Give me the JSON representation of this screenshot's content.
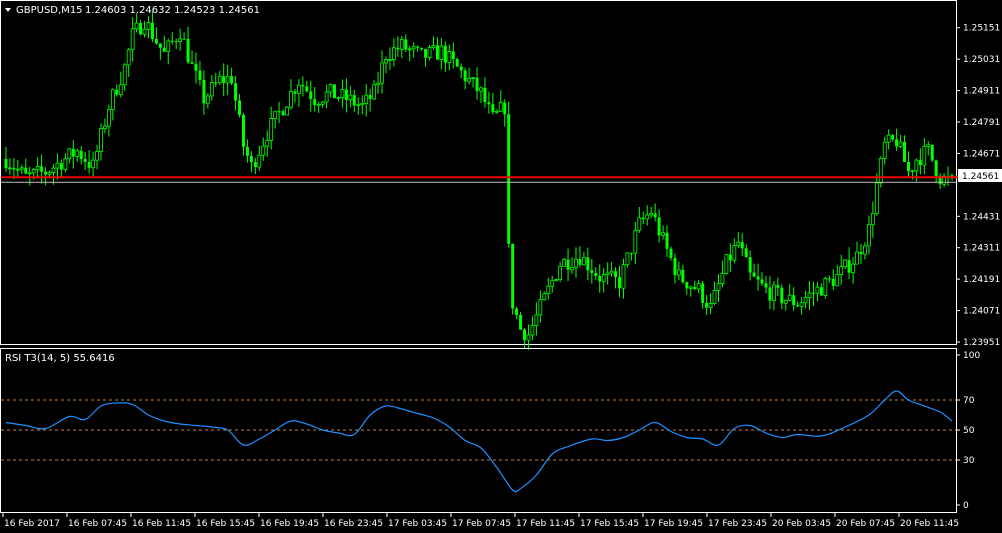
{
  "colors": {
    "background": "#000000",
    "foreground": "#ffffff",
    "bull_candle": "#00ff00",
    "bear_candle": "#00ff00",
    "price_line": "#ff0000",
    "rsi_line": "#1e90ff",
    "level_line": "#c08040",
    "panel_border": "#ffffff"
  },
  "chart_data": [
    {
      "type": "candlestick",
      "title": "GBPUSD,M15  1.24603 1.24632 1.24523 1.24561",
      "symbol": "GBPUSD,M15",
      "ohlc_label": "1.24603 1.24632 1.24523 1.24561",
      "collapse_icon": "triangle-down-icon",
      "ylim": [
        1.23951,
        1.25211
      ],
      "y_ticks": [
        "1.25151",
        "1.25031",
        "1.24911",
        "1.24791",
        "1.24671",
        "1.24431",
        "1.24311",
        "1.24191",
        "1.24071",
        "1.23951"
      ],
      "current_price": 1.24561,
      "current_price_label": "1.24561",
      "extra_levels": [
        1.24582,
        1.24578
      ],
      "candle_count": 240,
      "anchors": [
        [
          0,
          1.2465
        ],
        [
          5,
          1.2458
        ],
        [
          10,
          1.246
        ],
        [
          15,
          1.2465
        ],
        [
          18,
          1.2468
        ],
        [
          22,
          1.2462
        ],
        [
          26,
          1.2485
        ],
        [
          30,
          1.25
        ],
        [
          32,
          1.2512
        ],
        [
          35,
          1.2518
        ],
        [
          38,
          1.251
        ],
        [
          40,
          1.2505
        ],
        [
          44,
          1.2514
        ],
        [
          47,
          1.25
        ],
        [
          50,
          1.2488
        ],
        [
          54,
          1.2495
        ],
        [
          57,
          1.2496
        ],
        [
          60,
          1.247
        ],
        [
          62,
          1.2462
        ],
        [
          66,
          1.2475
        ],
        [
          70,
          1.2485
        ],
        [
          74,
          1.2495
        ],
        [
          78,
          1.2488
        ],
        [
          82,
          1.249
        ],
        [
          86,
          1.2488
        ],
        [
          90,
          1.2485
        ],
        [
          93,
          1.249
        ],
        [
          96,
          1.2505
        ],
        [
          100,
          1.2508
        ],
        [
          105,
          1.2504
        ],
        [
          110,
          1.2506
        ],
        [
          115,
          1.2498
        ],
        [
          120,
          1.249
        ],
        [
          123,
          1.248
        ],
        [
          126,
          1.2485
        ],
        [
          127,
          1.243
        ],
        [
          128,
          1.241
        ],
        [
          130,
          1.24
        ],
        [
          132,
          1.2398
        ],
        [
          135,
          1.2408
        ],
        [
          140,
          1.2425
        ],
        [
          145,
          1.2428
        ],
        [
          150,
          1.242
        ],
        [
          155,
          1.2418
        ],
        [
          160,
          1.244
        ],
        [
          163,
          1.2445
        ],
        [
          167,
          1.243
        ],
        [
          170,
          1.242
        ],
        [
          175,
          1.2415
        ],
        [
          178,
          1.2408
        ],
        [
          182,
          1.2425
        ],
        [
          185,
          1.2433
        ],
        [
          188,
          1.242
        ],
        [
          192,
          1.2415
        ],
        [
          196,
          1.2412
        ],
        [
          200,
          1.241
        ],
        [
          205,
          1.2415
        ],
        [
          210,
          1.242
        ],
        [
          215,
          1.2428
        ],
        [
          218,
          1.2438
        ],
        [
          220,
          1.2455
        ],
        [
          222,
          1.247
        ],
        [
          225,
          1.2472
        ],
        [
          228,
          1.246
        ],
        [
          230,
          1.2465
        ],
        [
          233,
          1.2468
        ],
        [
          236,
          1.2458
        ],
        [
          239,
          1.2456
        ]
      ]
    },
    {
      "type": "line",
      "title": "RSI T3(14, 5) 55.6416",
      "series": [
        {
          "name": "RSI T3(14, 5)",
          "last_value": "55.6416"
        }
      ],
      "ylim": [
        0,
        100
      ],
      "y_ticks": [
        "100",
        "70",
        "50",
        "30",
        "0"
      ],
      "levels": [
        70,
        50,
        30
      ],
      "x": [
        0,
        5,
        10,
        16,
        20,
        24,
        28,
        32,
        36,
        40,
        44,
        48,
        52,
        56,
        60,
        64,
        68,
        72,
        76,
        80,
        84,
        88,
        92,
        96,
        100,
        104,
        108,
        112,
        116,
        120,
        124,
        128,
        130,
        134,
        138,
        142,
        148,
        152,
        156,
        160,
        164,
        168,
        172,
        176,
        180,
        184,
        188,
        192,
        196,
        200,
        206,
        212,
        218,
        222,
        225,
        228,
        232,
        236,
        239
      ],
      "y": [
        55,
        53,
        51,
        59,
        57,
        66,
        68,
        67,
        60,
        56,
        54,
        53,
        52,
        50,
        40,
        44,
        50,
        56,
        54,
        50,
        48,
        47,
        60,
        66,
        64,
        61,
        58,
        52,
        43,
        38,
        25,
        10,
        11,
        20,
        34,
        39,
        44,
        43,
        45,
        50,
        55,
        49,
        45,
        44,
        40,
        51,
        53,
        48,
        45,
        47,
        46,
        52,
        60,
        70,
        76,
        70,
        66,
        62,
        56
      ]
    }
  ],
  "x_axis": {
    "labels": [
      "16 Feb 2017",
      "16 Feb 07:45",
      "16 Feb 11:45",
      "16 Feb 15:45",
      "16 Feb 19:45",
      "16 Feb 23:45",
      "17 Feb 03:45",
      "17 Feb 07:45",
      "17 Feb 11:45",
      "17 Feb 15:45",
      "17 Feb 19:45",
      "17 Feb 23:45",
      "20 Feb 03:45",
      "20 Feb 07:45",
      "20 Feb 11:45"
    ]
  }
}
